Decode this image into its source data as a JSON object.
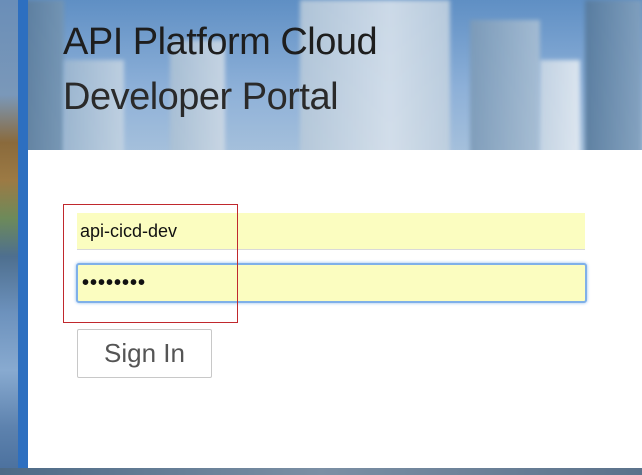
{
  "header": {
    "title": "API Platform Cloud",
    "subtitle": "Developer Portal"
  },
  "login": {
    "username_value": "api-cicd-dev",
    "password_value": "••••••••",
    "sign_in_label": "Sign In"
  },
  "colors": {
    "accent_blue": "#2d6fc0",
    "autofill_yellow": "#fbfdc0",
    "focus_blue": "#7fb0e8",
    "highlight_red": "#c0282d"
  }
}
